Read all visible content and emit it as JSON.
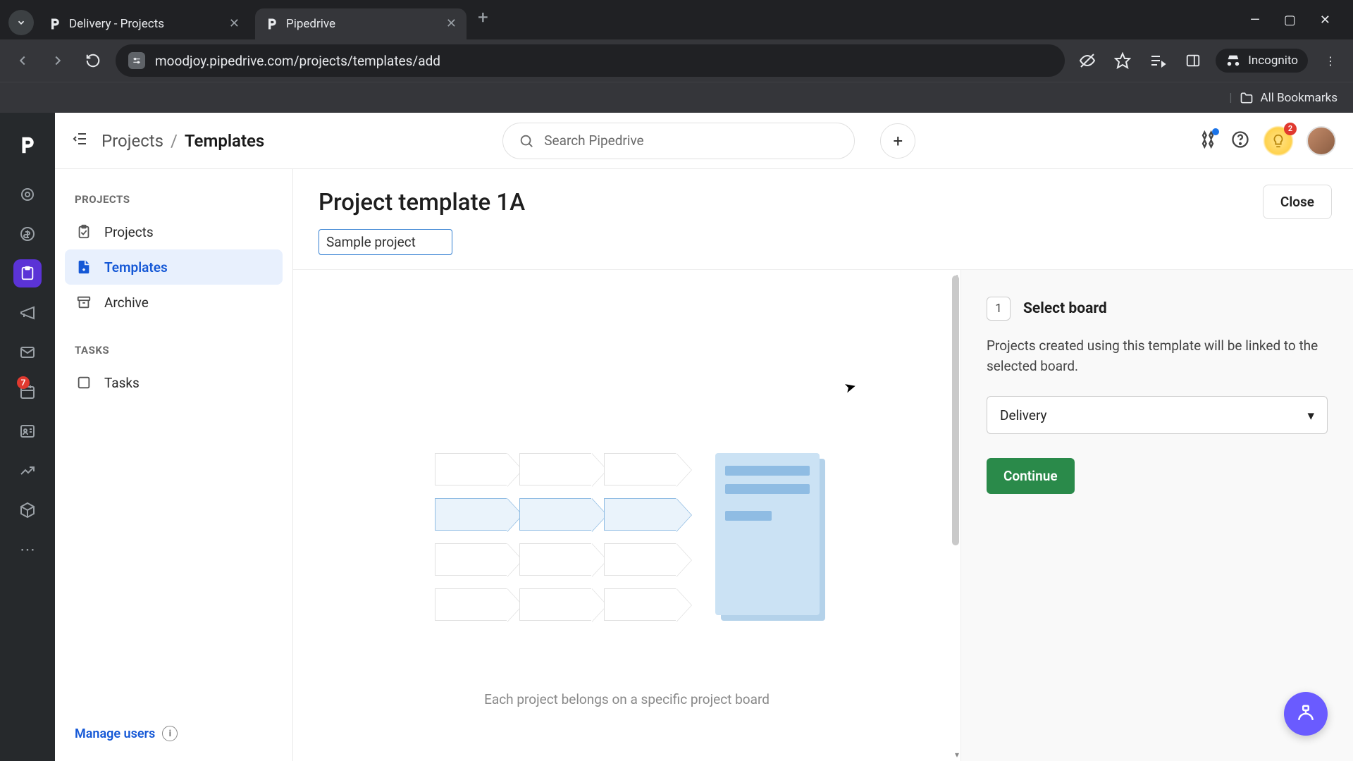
{
  "browser": {
    "tabs": [
      {
        "title": "Delivery - Projects",
        "active": false
      },
      {
        "title": "Pipedrive",
        "active": true
      }
    ],
    "url": "moodjoy.pipedrive.com/projects/templates/add",
    "incognito_label": "Incognito",
    "bookmarks_bar_label": "All Bookmarks"
  },
  "rail": {
    "notification_count": "7"
  },
  "appbar": {
    "breadcrumb_root": "Projects",
    "breadcrumb_sep": "/",
    "breadcrumb_current": "Templates",
    "search_placeholder": "Search Pipedrive",
    "lightbulb_badge": "2"
  },
  "nav": {
    "section_projects": "PROJECTS",
    "item_projects": "Projects",
    "item_templates": "Templates",
    "item_archive": "Archive",
    "section_tasks": "TASKS",
    "item_tasks": "Tasks",
    "manage_users": "Manage users"
  },
  "editor": {
    "title": "Project template 1A",
    "close": "Close",
    "tag_value": "Sample project",
    "preview_caption": "Each project belongs on a specific project board"
  },
  "wizard": {
    "step_number": "1",
    "step_title": "Select board",
    "step_desc": "Projects created using this template will be linked to the selected board.",
    "select_value": "Delivery",
    "continue": "Continue"
  }
}
